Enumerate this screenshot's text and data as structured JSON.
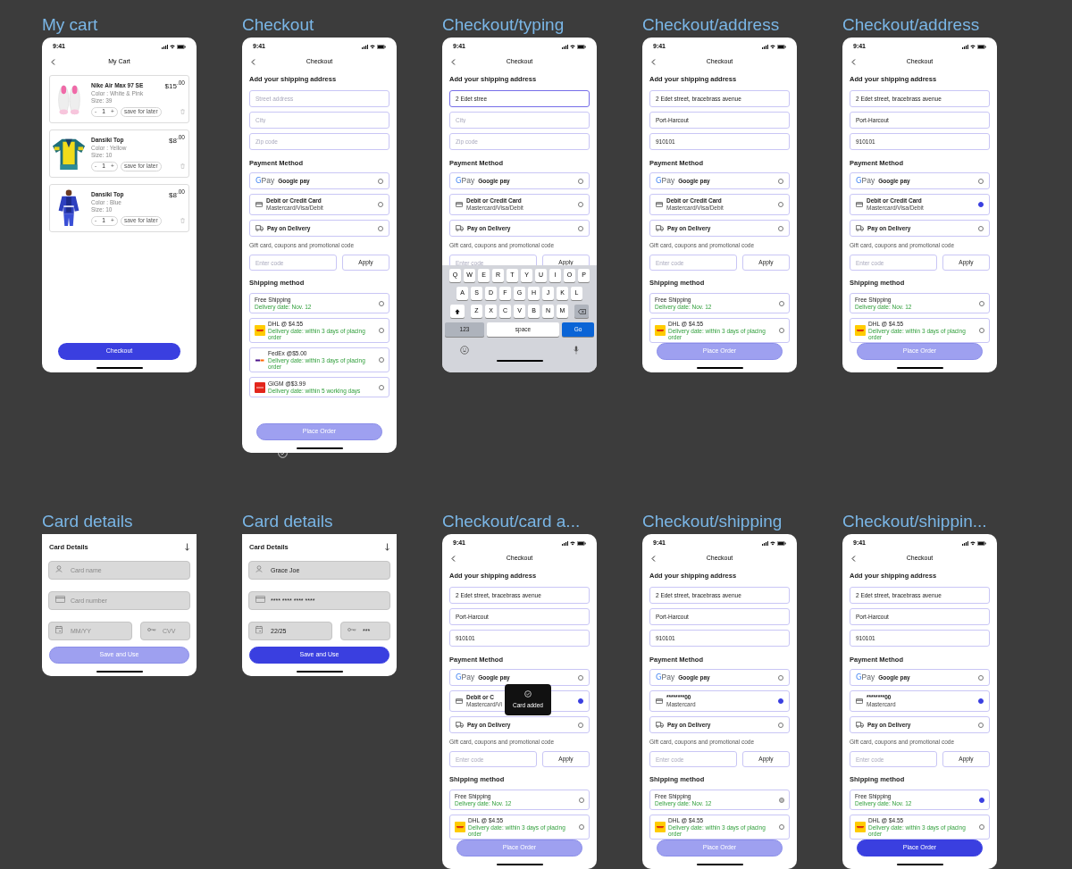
{
  "rows": [
    {
      "frames": [
        {
          "title": "My cart",
          "kind": "cart",
          "time": "9:41",
          "header": "My Cart",
          "items": [
            {
              "name": "Nike Air Max 97 SE",
              "price": "$15",
              "cents": ".00",
              "color_label": "Color : White & Pink",
              "size": "Size: 39",
              "minus": "-",
              "qty": "1",
              "plus": "+",
              "save": "save for later"
            },
            {
              "name": "Dansiki Top",
              "price": "$8",
              "cents": ".00",
              "color_label": "Color : Yellow",
              "size": "Size: 10",
              "minus": "-",
              "qty": "1",
              "plus": "+",
              "save": "save for later"
            },
            {
              "name": "Dansiki Top",
              "price": "$8",
              "cents": ".00",
              "color_label": "Color : Blue",
              "size": "Size: 10",
              "minus": "-",
              "qty": "1",
              "plus": "+",
              "save": "save for later"
            }
          ],
          "button": {
            "label": "Checkout",
            "disabled": false
          }
        },
        {
          "title": "Checkout",
          "kind": "checkout",
          "time": "9:41",
          "header": "Checkout",
          "address_heading": "Add your shipping address",
          "address_fields": [
            {
              "placeholder": "Street address",
              "focused": false
            },
            {
              "placeholder": "City",
              "focused": false
            },
            {
              "placeholder": "Zip code",
              "focused": false
            }
          ],
          "payment_heading": "Payment Method",
          "payments": [
            {
              "kind": "gpay",
              "logo": "G",
              "logo_suffix": "Pay",
              "label": "Google pay",
              "selected": false
            },
            {
              "kind": "card",
              "label": "Debit or Credit Card",
              "sublabel": "Mastercard/Visa/Debit",
              "selected": false
            },
            {
              "kind": "delivery",
              "label": "Pay on Delivery",
              "selected": false
            }
          ],
          "promo_label": "Gift card, coupons and promotional code",
          "promo_field": {
            "placeholder": "Enter code"
          },
          "apply": "Apply",
          "shipping_heading": "Shipping method",
          "shipping": [
            {
              "kind": "free",
              "label": "Free Shipping",
              "note": "Delivery date: Nov. 12",
              "selected": false,
              "pressed": false
            },
            {
              "kind": "dhl",
              "label": "DHL @ $4.55",
              "note": "Delivery date: within 3 days of placing order",
              "selected": false,
              "pressed": false
            },
            {
              "kind": "fedex",
              "label": "FedEx @$5.00",
              "note": "Delivery date: within 3 days of placing order",
              "selected": false,
              "pressed": false
            },
            {
              "kind": "gigm",
              "label": "GIGM @$3.99",
              "note": "Delivery date: within 5 working days",
              "selected": false,
              "pressed": false
            }
          ],
          "place_order": {
            "label": "Place Order",
            "disabled": true
          },
          "saved_mark": true
        },
        {
          "title": "Checkout/typing",
          "kind": "checkout",
          "time": "9:41",
          "header": "Checkout",
          "address_heading": "Add your shipping address",
          "address_fields": [
            {
              "value": "2 Edet stree",
              "focused": true
            },
            {
              "placeholder": "City",
              "focused": false
            },
            {
              "placeholder": "Zip code",
              "focused": false
            }
          ],
          "payment_heading": "Payment Method",
          "payments": [
            {
              "kind": "gpay",
              "logo": "G",
              "logo_suffix": "Pay",
              "label": "Google pay",
              "selected": false
            },
            {
              "kind": "card",
              "label": "Debit or Credit Card",
              "sublabel": "Mastercard/Visa/Debit",
              "selected": false
            },
            {
              "kind": "delivery",
              "label": "Pay on Delivery",
              "selected": false
            }
          ],
          "promo_label": "Gift card, coupons and promotional code",
          "promo_field": {
            "placeholder": "Enter code"
          },
          "apply": "Apply",
          "keyboard": {
            "rows": [
              [
                "Q",
                "W",
                "E",
                "R",
                "T",
                "Y",
                "U",
                "I",
                "O",
                "P"
              ],
              [
                "A",
                "S",
                "D",
                "F",
                "G",
                "H",
                "J",
                "K",
                "L"
              ],
              [
                "Z",
                "X",
                "C",
                "V",
                "B",
                "N",
                "M"
              ]
            ],
            "numbers": "123",
            "space": "space",
            "go": "Go"
          }
        },
        {
          "title": "Checkout/address",
          "kind": "checkout",
          "time": "9:41",
          "header": "Checkout",
          "address_heading": "Add your shipping address",
          "address_fields": [
            {
              "value": "2 Edet street, bracebrass avenue",
              "focused": false
            },
            {
              "value": "Port-Harcout",
              "focused": false
            },
            {
              "value": "910101",
              "focused": false
            }
          ],
          "payment_heading": "Payment Method",
          "payments": [
            {
              "kind": "gpay",
              "logo": "G",
              "logo_suffix": "Pay",
              "label": "Google pay",
              "selected": false
            },
            {
              "kind": "card",
              "label": "Debit or Credit Card",
              "sublabel": "Mastercard/Visa/Debit",
              "selected": false
            },
            {
              "kind": "delivery",
              "label": "Pay on Delivery",
              "selected": false
            }
          ],
          "promo_label": "Gift card, coupons and promotional code",
          "promo_field": {
            "placeholder": "Enter code"
          },
          "apply": "Apply",
          "shipping_heading": "Shipping method",
          "shipping": [
            {
              "kind": "free",
              "label": "Free Shipping",
              "note": "Delivery date: Nov. 12",
              "selected": false,
              "pressed": false
            },
            {
              "kind": "dhl",
              "label": "DHL @ $4.55",
              "note": "Delivery date: within 3 days of placing order",
              "selected": false,
              "pressed": false
            }
          ],
          "place_order": {
            "label": "Place Order",
            "disabled": true
          }
        },
        {
          "title": "Checkout/address",
          "kind": "checkout",
          "time": "9:41",
          "header": "Checkout",
          "address_heading": "Add your shipping address",
          "address_fields": [
            {
              "value": "2 Edet street, bracebrass avenue",
              "focused": false
            },
            {
              "value": "Port-Harcout",
              "focused": false
            },
            {
              "value": "910101",
              "focused": false
            }
          ],
          "payment_heading": "Payment Method",
          "payments": [
            {
              "kind": "gpay",
              "logo": "G",
              "logo_suffix": "Pay",
              "label": "Google pay",
              "selected": false
            },
            {
              "kind": "card",
              "label": "Debit or Credit Card",
              "sublabel": "Mastercard/Visa/Debit",
              "selected": true
            },
            {
              "kind": "delivery",
              "label": "Pay on Delivery",
              "selected": false
            }
          ],
          "promo_label": "Gift card, coupons and promotional code",
          "promo_field": {
            "placeholder": "Enter code"
          },
          "apply": "Apply",
          "shipping_heading": "Shipping method",
          "shipping": [
            {
              "kind": "free",
              "label": "Free Shipping",
              "note": "Delivery date: Nov. 12",
              "selected": false,
              "pressed": false
            },
            {
              "kind": "dhl",
              "label": "DHL @ $4.55",
              "note": "Delivery date: within 3 days of placing order",
              "selected": false,
              "pressed": false
            }
          ],
          "place_order": {
            "label": "Place Order",
            "disabled": true
          }
        }
      ]
    },
    {
      "frames": [
        {
          "title": "Card details",
          "kind": "card",
          "heading": "Card Details",
          "fields": [
            {
              "kind": "name",
              "placeholder": "Card name"
            },
            {
              "kind": "number",
              "placeholder": "Card number"
            },
            {
              "kind": "expiry",
              "placeholder": "MM/YY"
            },
            {
              "kind": "cvv",
              "placeholder": "CVV"
            }
          ],
          "button": {
            "label": "Save and Use",
            "disabled": true
          }
        },
        {
          "title": "Card details",
          "kind": "card",
          "heading": "Card Details",
          "fields": [
            {
              "kind": "name",
              "value": "Grace Joe"
            },
            {
              "kind": "number",
              "value": "**** **** **** ****"
            },
            {
              "kind": "expiry",
              "value": "22/25"
            },
            {
              "kind": "cvv",
              "value": "***"
            }
          ],
          "button": {
            "label": "Save and Use",
            "disabled": false
          }
        },
        {
          "title": "Checkout/card a...",
          "kind": "checkout",
          "time": "9:41",
          "header": "Checkout",
          "address_heading": "Add your shipping address",
          "address_fields": [
            {
              "value": "2 Edet street, bracebrass avenue",
              "focused": false
            },
            {
              "value": "Port-Harcout",
              "focused": false
            },
            {
              "value": "910101",
              "focused": false
            }
          ],
          "payment_heading": "Payment Method",
          "payments": [
            {
              "kind": "gpay",
              "logo": "G",
              "logo_suffix": "Pay",
              "label": "Google pay",
              "selected": false
            },
            {
              "kind": "card",
              "label": "Debit or C",
              "sublabel": "Mastercard/Vi",
              "selected": true
            },
            {
              "kind": "delivery",
              "label": "Pay on Delivery",
              "selected": false
            }
          ],
          "promo_label": "Gift card, coupons and promotional code",
          "promo_field": {
            "placeholder": "Enter code"
          },
          "apply": "Apply",
          "shipping_heading": "Shipping method",
          "shipping": [
            {
              "kind": "free",
              "label": "Free Shipping",
              "note": "Delivery date: Nov. 12",
              "selected": false,
              "pressed": false
            },
            {
              "kind": "dhl",
              "label": "DHL @ $4.55",
              "note": "Delivery date: within 3 days of placing order",
              "selected": false,
              "pressed": false
            }
          ],
          "place_order": {
            "label": "Place Order",
            "disabled": true
          },
          "toast": {
            "label": "Card added"
          }
        },
        {
          "title": "Checkout/shipping",
          "kind": "checkout",
          "time": "9:41",
          "header": "Checkout",
          "address_heading": "Add your shipping address",
          "address_fields": [
            {
              "value": "2 Edet street, bracebrass avenue",
              "focused": false
            },
            {
              "value": "Port-Harcout",
              "focused": false
            },
            {
              "value": "910101",
              "focused": false
            }
          ],
          "payment_heading": "Payment Method",
          "payments": [
            {
              "kind": "gpay",
              "logo": "G",
              "logo_suffix": "Pay",
              "label": "Google pay",
              "selected": false
            },
            {
              "kind": "card",
              "label": "********00",
              "sublabel": "Mastercard",
              "selected": true
            },
            {
              "kind": "delivery",
              "label": "Pay on Delivery",
              "selected": false
            }
          ],
          "promo_label": "Gift card, coupons and promotional code",
          "promo_field": {
            "placeholder": "Enter code"
          },
          "apply": "Apply",
          "shipping_heading": "Shipping method",
          "shipping": [
            {
              "kind": "free",
              "label": "Free Shipping",
              "note": "Delivery date: Nov. 12",
              "selected": false,
              "pressed": true
            },
            {
              "kind": "dhl",
              "label": "DHL @ $4.55",
              "note": "Delivery date: within 3 days of placing order",
              "selected": false,
              "pressed": false
            }
          ],
          "place_order": {
            "label": "Place Order",
            "disabled": true
          }
        },
        {
          "title": "Checkout/shippin...",
          "kind": "checkout",
          "time": "9:41",
          "header": "Checkout",
          "address_heading": "Add your shipping address",
          "address_fields": [
            {
              "value": "2 Edet street, bracebrass avenue",
              "focused": false
            },
            {
              "value": "Port-Harcout",
              "focused": false
            },
            {
              "value": "910101",
              "focused": false
            }
          ],
          "payment_heading": "Payment Method",
          "payments": [
            {
              "kind": "gpay",
              "logo": "G",
              "logo_suffix": "Pay",
              "label": "Google pay",
              "selected": false
            },
            {
              "kind": "card",
              "label": "********00",
              "sublabel": "Mastercard",
              "selected": true
            },
            {
              "kind": "delivery",
              "label": "Pay on Delivery",
              "selected": false
            }
          ],
          "promo_label": "Gift card, coupons and promotional code",
          "promo_field": {
            "placeholder": "Enter code"
          },
          "apply": "Apply",
          "shipping_heading": "Shipping method",
          "shipping": [
            {
              "kind": "free",
              "label": "Free Shipping",
              "note": "Delivery date: Nov. 12",
              "selected": true,
              "pressed": false
            },
            {
              "kind": "dhl",
              "label": "DHL @ $4.55",
              "note": "Delivery date: within 3 days of placing order",
              "selected": false,
              "pressed": false
            }
          ],
          "place_order": {
            "label": "Place Order",
            "disabled": false
          }
        }
      ]
    }
  ]
}
